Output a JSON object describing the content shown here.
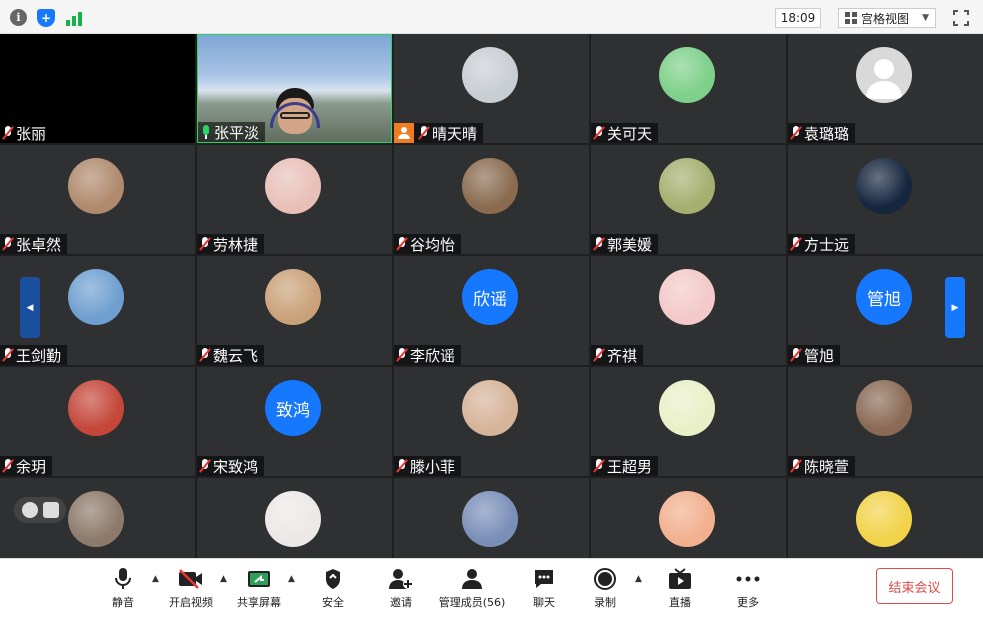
{
  "topbar": {
    "time": "18:09",
    "view_label": "宫格视图"
  },
  "tiles": [
    {
      "name": "张丽",
      "mic": "muted",
      "avatar": "none",
      "bg": "dark"
    },
    {
      "name": "张平淡",
      "mic": "active",
      "avatar": "video",
      "bg": "scenic"
    },
    {
      "name": "晴天晴",
      "mic": "muted",
      "avatar": "photo",
      "host": true,
      "color": "#c9ced3"
    },
    {
      "name": "关可天",
      "mic": "muted",
      "avatar": "photo",
      "color": "#7ed08a"
    },
    {
      "name": "袁璐璐",
      "mic": "muted",
      "avatar": "default",
      "color": "#d9d9d9"
    },
    {
      "name": "张卓然",
      "mic": "muted",
      "avatar": "photo",
      "color": "#b08a6e"
    },
    {
      "name": "劳林捷",
      "mic": "muted",
      "avatar": "photo",
      "color": "#e8c0b8"
    },
    {
      "name": "谷均怡",
      "mic": "muted",
      "avatar": "photo",
      "color": "#8a6b50"
    },
    {
      "name": "郭美媛",
      "mic": "muted",
      "avatar": "photo",
      "color": "#a5b070"
    },
    {
      "name": "方士远",
      "mic": "muted",
      "avatar": "photo",
      "color": "#16263f"
    },
    {
      "name": "王剑勤",
      "mic": "muted",
      "avatar": "photo",
      "color": "#6f9fd0"
    },
    {
      "name": "魏云飞",
      "mic": "muted",
      "avatar": "photo",
      "color": "#caa27a"
    },
    {
      "name": "李欣谣",
      "mic": "muted",
      "avatar": "text",
      "avatar_text": "欣谣"
    },
    {
      "name": "齐祺",
      "mic": "muted",
      "avatar": "photo",
      "color": "#f3c9c9"
    },
    {
      "name": "管旭",
      "mic": "muted",
      "avatar": "text",
      "avatar_text": "管旭"
    },
    {
      "name": "余玥",
      "mic": "muted",
      "avatar": "photo",
      "color": "#c4473a"
    },
    {
      "name": "宋致鸿",
      "mic": "muted",
      "avatar": "text",
      "avatar_text": "致鸿"
    },
    {
      "name": "滕小菲",
      "mic": "muted",
      "avatar": "photo",
      "color": "#d6b49a"
    },
    {
      "name": "王超男",
      "mic": "muted",
      "avatar": "photo",
      "color": "#e9f0c8"
    },
    {
      "name": "陈晓萱",
      "mic": "muted",
      "avatar": "photo",
      "color": "#8a6a55"
    },
    {
      "name": "",
      "mic": "none",
      "avatar": "photo",
      "color": "#8d7a6a"
    },
    {
      "name": "",
      "mic": "none",
      "avatar": "photo",
      "color": "#ece8e8"
    },
    {
      "name": "",
      "mic": "none",
      "avatar": "photo",
      "color": "#7a8fb8"
    },
    {
      "name": "",
      "mic": "none",
      "avatar": "photo",
      "color": "#f2b08f"
    },
    {
      "name": "",
      "mic": "none",
      "avatar": "photo",
      "color": "#f2d34a"
    }
  ],
  "toolbar": {
    "mute": "静音",
    "video": "开启视频",
    "share": "共享屏幕",
    "security": "安全",
    "invite": "邀请",
    "members": "管理成员(56)",
    "chat": "聊天",
    "record": "录制",
    "live": "直播",
    "more": "更多",
    "end": "结束会议"
  }
}
